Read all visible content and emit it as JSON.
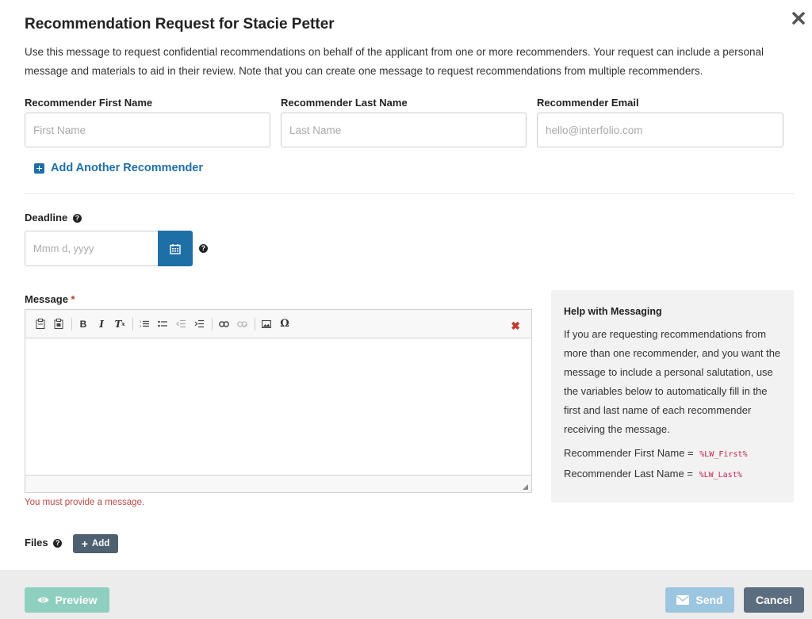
{
  "modal": {
    "title": "Recommendation Request for Stacie Petter",
    "intro": "Use this message to request confidential recommendations on behalf of the applicant from one or more recommenders. Your request can include a personal message and materials to aid in their review. Note that you can create one message to request recommendations from multiple recommenders."
  },
  "recommender": {
    "first_name_label": "Recommender First Name",
    "first_name_placeholder": "First Name",
    "last_name_label": "Recommender Last Name",
    "last_name_placeholder": "Last Name",
    "email_label": "Recommender Email",
    "email_placeholder": "hello@interfolio.com",
    "add_another_label": "Add Another Recommender"
  },
  "deadline": {
    "label": "Deadline",
    "placeholder": "Mmm d, yyyy"
  },
  "message": {
    "label": "Message",
    "required_mark": "*",
    "error": "You must provide a message."
  },
  "help": {
    "title": "Help with Messaging",
    "body": "If you are requesting recommendations from more than one recommender, and you want the message to include a personal salutation, use the variables below to automatically fill in the first and last name of each recommender receiving the message.",
    "first_label": "Recommender First Name =",
    "first_var": "%LW_First%",
    "last_label": "Recommender Last Name =",
    "last_var": "%LW_Last%"
  },
  "files": {
    "label": "Files",
    "add_label": "Add"
  },
  "footer": {
    "preview_label": "Preview",
    "send_label": "Send",
    "cancel_label": "Cancel"
  },
  "colors": {
    "primary": "#1f6fa7",
    "preview": "#8fcfc0",
    "send": "#9cc5df",
    "cancel": "#5b6d7e",
    "error": "#b94a48"
  }
}
